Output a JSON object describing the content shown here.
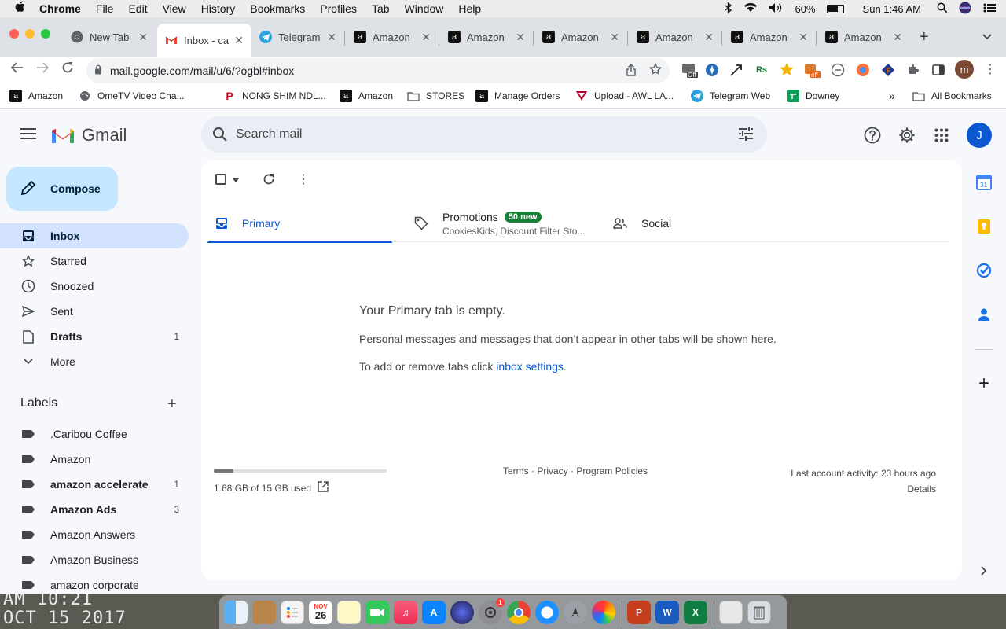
{
  "menubar": {
    "app": "Chrome",
    "items": [
      "File",
      "Edit",
      "View",
      "History",
      "Bookmarks",
      "Profiles",
      "Tab",
      "Window",
      "Help"
    ],
    "battery": "60%",
    "clock": "Sun 1:46 AM"
  },
  "tabs": [
    {
      "title": "New Tab",
      "favicon": "chrome-icon"
    },
    {
      "title": "Inbox - ca",
      "favicon": "gmail-icon",
      "active": true
    },
    {
      "title": "Telegram",
      "favicon": "telegram-icon"
    },
    {
      "title": "Amazon",
      "favicon": "amazon-icon"
    },
    {
      "title": "Amazon",
      "favicon": "amazon-icon"
    },
    {
      "title": "Amazon",
      "favicon": "amazon-icon"
    },
    {
      "title": "Amazon",
      "favicon": "amazon-icon"
    },
    {
      "title": "Amazon",
      "favicon": "amazon-icon"
    },
    {
      "title": "Amazon",
      "favicon": "amazon-icon"
    }
  ],
  "toolbar": {
    "url": "mail.google.com/mail/u/6/?ogbl#inbox",
    "profile_initial": "m",
    "ext_off_label": "off",
    "ext_off_label2": "Off",
    "ext_rs_label": "Rs"
  },
  "bookmarks": [
    {
      "label": "Amazon",
      "icon": "amazon-icon"
    },
    {
      "label": "OmeTV Video Cha...",
      "icon": "globe-icon"
    },
    {
      "label": "NONG SHIM NDL...",
      "icon": "pinterest-icon"
    },
    {
      "label": "Amazon",
      "icon": "amazon-icon"
    },
    {
      "label": "STORES",
      "icon": "folder-icon"
    },
    {
      "label": "Manage Orders",
      "icon": "amazon-icon"
    },
    {
      "label": "Upload - AWL LA...",
      "icon": "awl-icon"
    },
    {
      "label": "Telegram Web",
      "icon": "telegram-icon"
    },
    {
      "label": "Downey",
      "icon": "sheets-icon"
    }
  ],
  "bookmarks_more": "»",
  "bookmarks_all": "All Bookmarks",
  "gmail": {
    "logo_text": "Gmail",
    "search_placeholder": "Search mail",
    "account_initial": "J",
    "compose_label": "Compose",
    "nav": [
      {
        "label": "Inbox",
        "icon": "inbox-icon",
        "active": true,
        "count": ""
      },
      {
        "label": "Starred",
        "icon": "star-icon",
        "count": ""
      },
      {
        "label": "Snoozed",
        "icon": "clock-icon",
        "count": ""
      },
      {
        "label": "Sent",
        "icon": "send-icon",
        "count": ""
      },
      {
        "label": "Drafts",
        "icon": "draft-icon",
        "count": "1",
        "bold": true
      },
      {
        "label": "More",
        "icon": "chevron-down-icon",
        "count": ""
      }
    ],
    "labels_heading": "Labels",
    "labels": [
      {
        "label": ".Caribou Coffee",
        "count": "",
        "bold": false
      },
      {
        "label": "Amazon",
        "count": "",
        "bold": false
      },
      {
        "label": "amazon accelerate",
        "count": "1",
        "bold": true
      },
      {
        "label": "Amazon Ads",
        "count": "3",
        "bold": true
      },
      {
        "label": "Amazon Answers",
        "count": "",
        "bold": false
      },
      {
        "label": "Amazon Business",
        "count": "",
        "bold": false
      },
      {
        "label": "amazon corporate",
        "count": "",
        "bold": false
      }
    ],
    "tabs": {
      "primary": "Primary",
      "promotions": "Promotions",
      "promotions_badge": "50 new",
      "promotions_sub": "CookiesKids, Discount Filter Sto...",
      "social": "Social"
    },
    "empty": {
      "title": "Your Primary tab is empty.",
      "line1": "Personal messages and messages that don’t appear in other tabs will be shown here.",
      "line2_prefix": "To add or remove tabs click ",
      "line2_link": "inbox settings",
      "line2_suffix": "."
    },
    "storage": {
      "text": "1.68 GB of 15 GB used",
      "fraction": 0.112
    },
    "footer": {
      "terms": "Terms",
      "privacy": "Privacy",
      "policies": "Program Policies",
      "sep": " · "
    },
    "activity": {
      "line1": "Last account activity: 23 hours ago",
      "line2": "Details"
    }
  },
  "desktop": {
    "line1": "AM 10:21",
    "line2": "OCT 15 2017"
  },
  "dock": {
    "calendar_month": "NOV",
    "calendar_day": "26",
    "sysprefs_badge": "1"
  },
  "colors": {
    "accent": "#0b57d0",
    "compose": "#c2e7ff",
    "active_nav": "#d3e3fd",
    "badge": "#188038"
  }
}
